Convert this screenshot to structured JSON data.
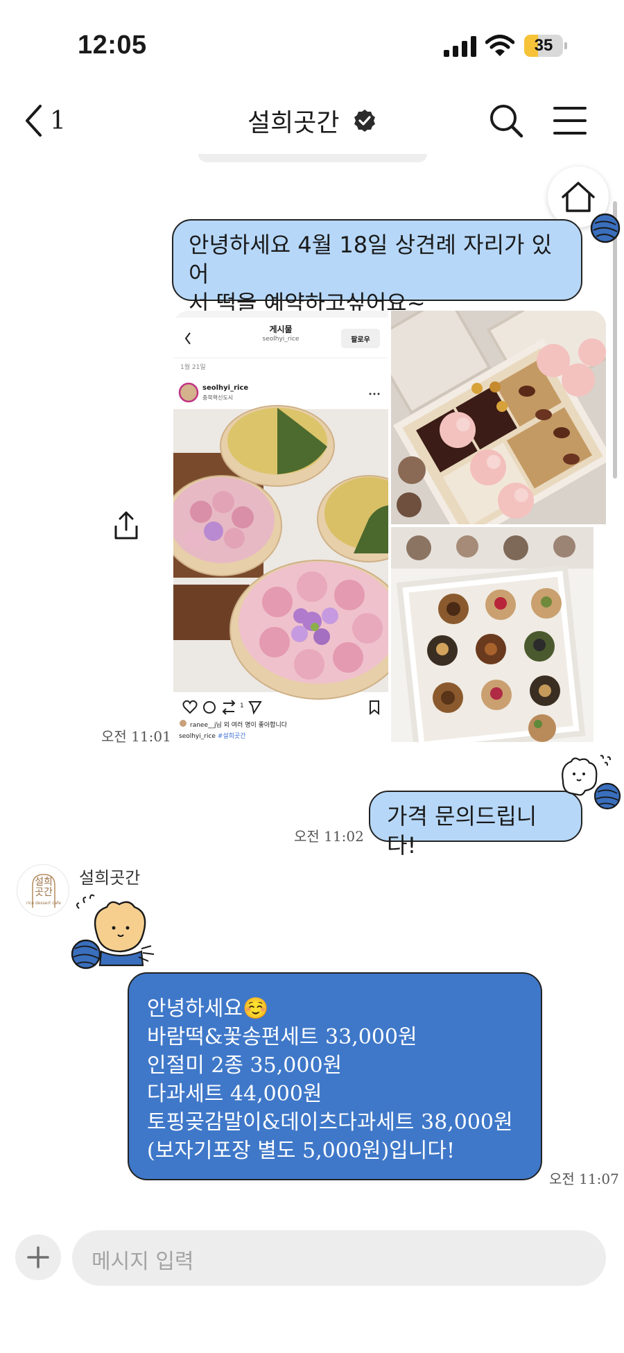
{
  "status_bar": {
    "time": "12:05",
    "battery_level": 35,
    "battery_text": "35",
    "battery_color": "#f6c338"
  },
  "header": {
    "back_count": "1",
    "title": "설희곳간",
    "verified_icon": "verified-badge-icon",
    "search_icon": "search-icon",
    "menu_icon": "hamburger-menu-icon"
  },
  "home_icon": "home-icon",
  "messages": {
    "m1": {
      "text_line1": "안녕하세요 4월 18일 상견례 자리가 있어",
      "text_line2": "서 떡을 예약하고싶어요~"
    },
    "photo": {
      "time": "오전 11:01",
      "instagram": {
        "header": "게시물",
        "account_top": "seolhyi_rice",
        "follow": "팔로우",
        "date": "1월 21일",
        "account": "seolhyi_rice",
        "location": "충북혁신도시",
        "repost_count": "1",
        "likes": "ranee__j님 외 여러 명이 좋아합니다",
        "caption_account": "seolhyi_rice",
        "caption_tag": "#설희곳간"
      }
    },
    "m2": {
      "text": "가격 문의드립니다!",
      "time": "오전 11:02"
    },
    "reply": {
      "sender": "설희곳간",
      "avatar_line1": "설희",
      "avatar_line2": "곳간",
      "avatar_sub": "rice dessert cafe",
      "line1": "안녕하세요☺️",
      "line2": "바람떡&꽃송편세트 33,000원",
      "line3": "인절미 2종 35,000원",
      "line4": "다과세트 44,000원",
      "line5": "토핑곶감말이&데이츠다과세트 38,000원",
      "line6": "(보자기포장 별도 5,000원)입니다!",
      "time": "오전 11:07"
    }
  },
  "composer": {
    "placeholder": "메시지 입력",
    "add_icon": "plus-icon"
  },
  "colors": {
    "my_bubble": "#b6d7f8",
    "their_bubble": "#3f78c9",
    "yarn_ball": "#3a6fbd"
  }
}
